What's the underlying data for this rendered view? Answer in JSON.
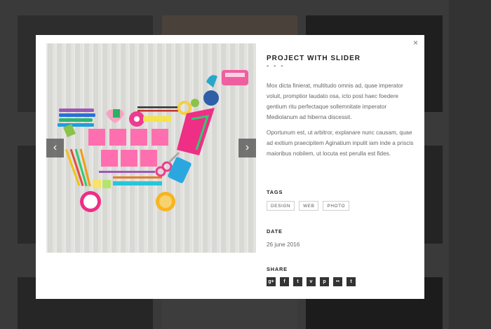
{
  "modal": {
    "close_icon": "×",
    "title": "PROJECT WITH SLIDER",
    "title_dash": "- - -",
    "description": [
      "Mox dicta finierat, multitudo omnis ad, quae imperator voluit, promptior laudato osa, icto post haec foedere gentium ritu perfectaque sollemnitate imperator Mediolanum ad hiberna discessit.",
      "Oportunum est, ut arbitror, explanare nunc causam, quae ad exitium praecipitem Aginatium inpulit iam inde a priscis maioribus nobilem, ut locuta est perulla est fides."
    ],
    "tags_label": "TAGS",
    "tags": [
      "DESIGN",
      "WEB",
      "PHOTO"
    ],
    "date_label": "DATE",
    "date_value": "26 june 2016",
    "share_label": "SHARE",
    "share_icons": [
      {
        "name": "google-plus",
        "glyph": "g+"
      },
      {
        "name": "facebook",
        "glyph": "f"
      },
      {
        "name": "twitter",
        "glyph": "t"
      },
      {
        "name": "vimeo",
        "glyph": "v"
      },
      {
        "name": "pinterest",
        "glyph": "p"
      },
      {
        "name": "flickr",
        "glyph": "••"
      },
      {
        "name": "tumblr",
        "glyph": "t"
      }
    ]
  },
  "slider": {
    "prev_glyph": "‹",
    "next_glyph": "›"
  }
}
